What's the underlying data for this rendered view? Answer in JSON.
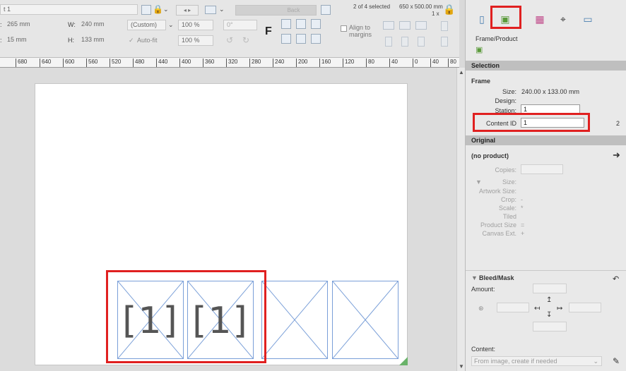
{
  "toolbar": {
    "doc_label": "t 1",
    "x_label": ":",
    "x_value": "265 mm",
    "y_label": ":",
    "y_value": "15 mm",
    "w_label": "W:",
    "w_value": "240 mm",
    "h_label": "H:",
    "h_value": "133 mm",
    "size_preset": "(Custom)",
    "autofit_label": "Auto-fit",
    "scale_x": "100 %",
    "scale_y": "100 %",
    "rotation": "0°",
    "back_label": "Back",
    "f_label": "F",
    "align_label_1": "Align to",
    "align_label_2": "margins",
    "selection_count": "2 of 4 selected",
    "sheet_size": "650 x 500.00 mm",
    "copies": "1 x"
  },
  "ruler": {
    "labels": [
      "680",
      "640",
      "600",
      "560",
      "520",
      "480",
      "440",
      "400",
      "360",
      "320",
      "280",
      "240",
      "200",
      "160",
      "120",
      "80",
      "40",
      "0",
      "40",
      "80"
    ]
  },
  "canvas": {
    "frames": [
      {
        "label": "[1]",
        "highlighted": true
      },
      {
        "label": "[1]",
        "highlighted": true
      },
      {
        "label": "",
        "highlighted": false
      },
      {
        "label": "",
        "highlighted": false
      }
    ]
  },
  "panel": {
    "tab_title": "Frame/Product",
    "selection_header": "Selection",
    "frame_title": "Frame",
    "size_label": "Size:",
    "size_value": "240.00 x 133.00 mm",
    "design_label": "Design:",
    "station_label": "Station:",
    "station_value": "1",
    "content_id_label": "Content ID",
    "content_id_value": "1",
    "content_id_side": "2",
    "original_header": "Original",
    "no_product": "(no product)",
    "copies_label": "Copies:",
    "size2_label": "Size:",
    "artwork_size_label": "Artwork Size:",
    "crop_label": "Crop:",
    "crop_value": "-",
    "scale_label": "Scale:",
    "scale_value": "*",
    "tiled_label": "Tiled",
    "product_size_label": "Product Size",
    "product_size_value": "=",
    "canvas_ext_label": "Canvas Ext.",
    "canvas_ext_value": "+",
    "bleed_header": "Bleed/Mask",
    "amount_label": "Amount:",
    "content_label": "Content:",
    "content_value": "From image, create if needed"
  },
  "colors": {
    "highlight": "#e02020",
    "frame_border": "#7a9fd8",
    "section_head": "#bfbfbf"
  }
}
